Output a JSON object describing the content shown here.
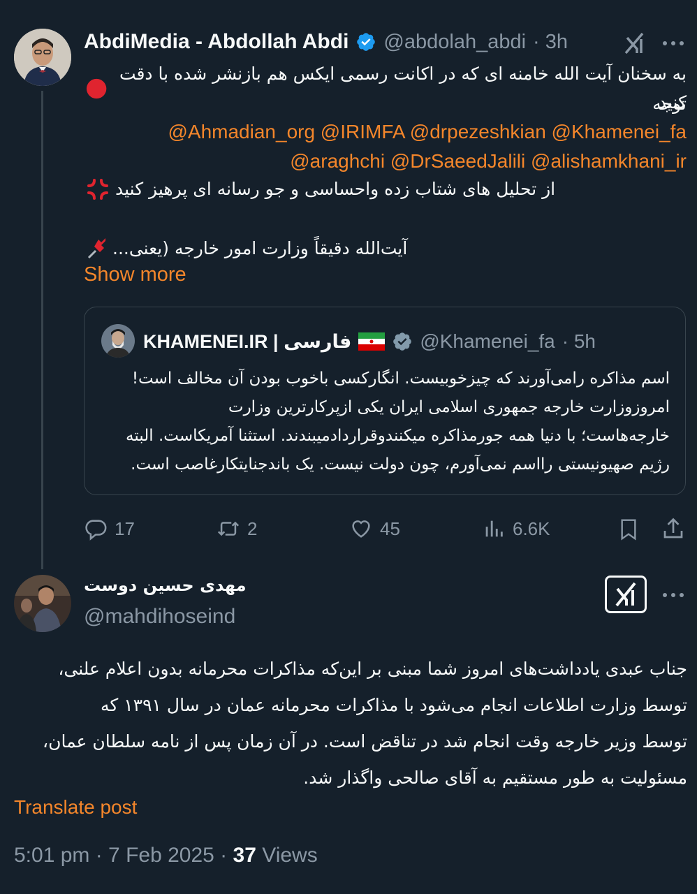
{
  "colors": {
    "background": "#15202b",
    "accent": "#f4862b",
    "muted": "#8b98a5",
    "verified": "#1d9bf0",
    "divider": "#38444d"
  },
  "tweet": {
    "author_name": "AbdiMedia - Abdollah Abdi",
    "handle": "@abdolah_abdi",
    "time": "· 3h",
    "line1": "به سخنان آیت الله خامنه ای که در اکانت رسمی ایکس هم بازنشر شده با دقت توجه",
    "line2": "کنید",
    "mentions_line1": "@Ahmadian_org @IRIMFA @drpezeshkian @Khamenei_fa",
    "mentions_line2": "@araghchi @DrSaeedJalili @alishamkhani_ir",
    "line3": "از تحلیل های شتاب زده واحساسی و جو رسانه ای پرهیز کنید",
    "line4": "آیت‌الله دقیقاً وزارت امور خارجه (یعنی...",
    "show_more": "Show more",
    "icons": [
      "red-circle-icon",
      "anger-icon",
      "pushpin-icon",
      "grok-icon",
      "more-icon",
      "verified-badge-icon"
    ]
  },
  "quote": {
    "name": "KHAMENEI.IR | فارسی",
    "handle": "@Khamenei_fa",
    "time": "· 5h",
    "lines": [
      "اسم مذاکره رامی‌آورند که چیزخوبیست. انگارکسی باخوب بودن آن مخالف است!",
      "امروزوزارت خارجه جمهوری اسلامی ایران یکی ازپرکارترین وزارت",
      "خارجه‌هاست؛ با دنیا همه جورمذاکره میکنندوقراردادمیبندند. استثنا آمریکاست. البته",
      "رژیم صهیونیستی رااسم نمی‌آورم، چون دولت نیست. یک باندجنایتکارغاصب است."
    ]
  },
  "actions": {
    "replies": "17",
    "reposts": "2",
    "likes": "45",
    "views": "6.6K"
  },
  "reply": {
    "author_name": "مهدی حسین دوست",
    "handle": "@mahdihoseind",
    "lines": [
      "جناب عبدی یادداشت‌های امروز شما مبنی بر این‌که مذاکرات محرمانه بدون اعلام علنی،",
      "توسط وزارت اطلاعات انجام می‌شود با مذاکرات محرمانه عمان در سال ۱۳۹۱ که",
      "توسط وزیر خارجه وقت انجام شد در تناقض است. در آن زمان پس از نامه سلطان عمان،",
      "مسئولیت به طور مستقیم به آقای صالحی واگذار شد."
    ],
    "translate": "Translate post",
    "timestamp": "5:01 pm · 7 Feb 2025 ·",
    "views_count": "37",
    "views_label": "Views"
  }
}
